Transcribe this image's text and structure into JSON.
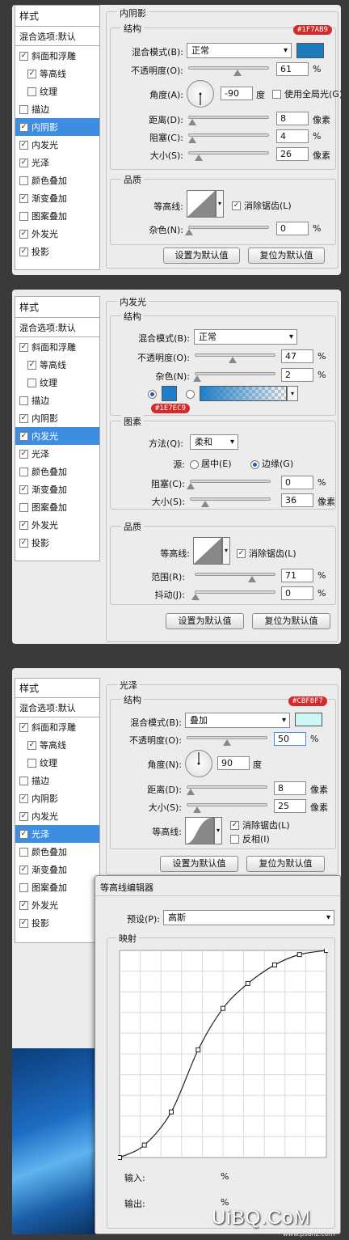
{
  "panel1": {
    "sidebar": {
      "title": "样式",
      "blend": "混合选项:默认",
      "items": [
        {
          "label": "斜面和浮雕",
          "checked": "✓"
        },
        {
          "label": "等高线",
          "checked": "✓"
        },
        {
          "label": "纹理",
          "checked": ""
        },
        {
          "label": "描边",
          "checked": ""
        },
        {
          "label": "内阴影",
          "checked": "✓"
        },
        {
          "label": "内发光",
          "checked": "✓"
        },
        {
          "label": "光泽",
          "checked": "✓"
        },
        {
          "label": "颜色叠加",
          "checked": ""
        },
        {
          "label": "渐变叠加",
          "checked": "✓"
        },
        {
          "label": "图案叠加",
          "checked": ""
        },
        {
          "label": "外发光",
          "checked": "✓"
        },
        {
          "label": "投影",
          "checked": "✓"
        }
      ]
    },
    "section_title": "内阴影",
    "structure_title": "结构",
    "color_tag": "#1F7AB9",
    "color": "#1f7ab9",
    "blend_mode_label": "混合模式(B):",
    "blend_mode_value": "正常",
    "opacity_label": "不透明度(O):",
    "opacity_value": "61",
    "angle_label": "角度(A):",
    "angle_value": "-90",
    "angle_unit": "度",
    "global_light_label": "使用全局光(G)",
    "distance_label": "距离(D):",
    "distance_value": "8",
    "choke_label": "阻塞(C):",
    "choke_value": "4",
    "size_label": "大小(S):",
    "size_value": "26",
    "pixel_unit": "像素",
    "percent": "%",
    "quality_title": "品质",
    "contour_label": "等高线:",
    "antialias_label": "消除锯齿(L)",
    "noise_label": "杂色(N):",
    "noise_value": "0",
    "btn_default": "设置为默认值",
    "btn_reset": "复位为默认值"
  },
  "panel2": {
    "sidebar": {
      "title": "样式",
      "blend": "混合选项:默认",
      "items": [
        {
          "label": "斜面和浮雕",
          "checked": "✓"
        },
        {
          "label": "等高线",
          "checked": "✓"
        },
        {
          "label": "纹理",
          "checked": ""
        },
        {
          "label": "描边",
          "checked": ""
        },
        {
          "label": "内阴影",
          "checked": "✓"
        },
        {
          "label": "内发光",
          "checked": "✓"
        },
        {
          "label": "光泽",
          "checked": "✓"
        },
        {
          "label": "颜色叠加",
          "checked": ""
        },
        {
          "label": "渐变叠加",
          "checked": "✓"
        },
        {
          "label": "图案叠加",
          "checked": ""
        },
        {
          "label": "外发光",
          "checked": "✓"
        },
        {
          "label": "投影",
          "checked": "✓"
        }
      ]
    },
    "section_title": "内发光",
    "structure_title": "结构",
    "blend_mode_label": "混合模式(B):",
    "blend_mode_value": "正常",
    "opacity_label": "不透明度(O):",
    "opacity_value": "47",
    "noise_label": "杂色(N):",
    "noise_value": "2",
    "color_tag": "#1E7EC9",
    "color": "#1e7ec9",
    "elements_title": "图素",
    "method_label": "方法(Q):",
    "method_value": "柔和",
    "source_label": "源:",
    "source_center": "居中(E)",
    "source_edge": "边缘(G)",
    "choke_label": "阻塞(C):",
    "choke_value": "0",
    "size_label": "大小(S):",
    "size_value": "36",
    "pixel_unit": "像素",
    "percent": "%",
    "quality_title": "品质",
    "contour_label": "等高线:",
    "antialias_label": "消除锯齿(L)",
    "range_label": "范围(R):",
    "range_value": "71",
    "jitter_label": "抖动(J):",
    "jitter_value": "0",
    "btn_default": "设置为默认值",
    "btn_reset": "复位为默认值"
  },
  "panel3": {
    "sidebar": {
      "title": "样式",
      "blend": "混合选项:默认",
      "items": [
        {
          "label": "斜面和浮雕",
          "checked": "✓"
        },
        {
          "label": "等高线",
          "checked": "✓"
        },
        {
          "label": "纹理",
          "checked": ""
        },
        {
          "label": "描边",
          "checked": ""
        },
        {
          "label": "内阴影",
          "checked": "✓"
        },
        {
          "label": "内发光",
          "checked": "✓"
        },
        {
          "label": "光泽",
          "checked": "✓"
        },
        {
          "label": "颜色叠加",
          "checked": ""
        },
        {
          "label": "渐变叠加",
          "checked": "✓"
        },
        {
          "label": "图案叠加",
          "checked": ""
        },
        {
          "label": "外发光",
          "checked": "✓"
        },
        {
          "label": "投影",
          "checked": "✓"
        }
      ]
    },
    "section_title": "光泽",
    "structure_title": "结构",
    "color_tag": "#CBF8F7",
    "color": "#cbf8f7",
    "blend_mode_label": "混合模式(B):",
    "blend_mode_value": "叠加",
    "opacity_label": "不透明度(O):",
    "opacity_value": "50",
    "angle_label": "角度(N):",
    "angle_value": "90",
    "angle_unit": "度",
    "distance_label": "距离(D):",
    "distance_value": "8",
    "size_label": "大小(S):",
    "size_value": "25",
    "pixel_unit": "像素",
    "percent": "%",
    "contour_label": "等高线:",
    "antialias_label": "消除锯齿(L)",
    "invert_label": "反相(I)",
    "btn_default": "设置为默认值",
    "btn_reset": "复位为默认值"
  },
  "contour_editor": {
    "title": "等高线编辑器",
    "preset_label": "预设(P):",
    "preset_value": "高斯",
    "mapping_title": "映射",
    "input_label": "输入:",
    "output_label": "输出:",
    "percent": "%",
    "curve_points": [
      [
        0,
        0
      ],
      [
        0.12,
        0.06
      ],
      [
        0.25,
        0.22
      ],
      [
        0.38,
        0.52
      ],
      [
        0.5,
        0.72
      ],
      [
        0.62,
        0.84
      ],
      [
        0.75,
        0.93
      ],
      [
        0.87,
        0.98
      ],
      [
        1,
        1
      ]
    ]
  },
  "watermark": {
    "brand": "UiBQ.CoM",
    "site": "www.psahz.com"
  }
}
